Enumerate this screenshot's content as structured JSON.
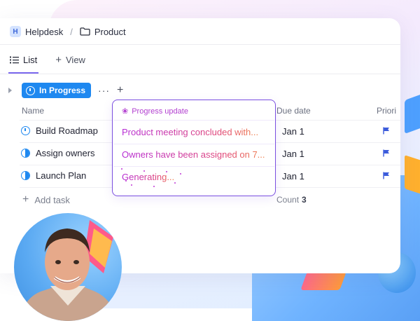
{
  "breadcrumb": {
    "space_initial": "H",
    "space_name": "Helpdesk",
    "separator": "/",
    "folder_name": "Product"
  },
  "views": {
    "list_label": "List",
    "add_view_label": "View"
  },
  "group": {
    "status_label": "In Progress",
    "status_color": "#1e88f0",
    "more": "···",
    "add": "+"
  },
  "columns": {
    "name": "Name",
    "due_date": "Due date",
    "priority": "Priori"
  },
  "ai_column": {
    "header": "Progress update",
    "cells": [
      "Product meeting concluded with...",
      "Owners have been assigned on 7...",
      "Generating..."
    ]
  },
  "tasks": [
    {
      "name": "Build Roadmap",
      "status_icon": "in-progress-icon",
      "due": "Jan 1",
      "flag_color": "#3b5bdb"
    },
    {
      "name": "Assign owners",
      "status_icon": "half-circle-icon",
      "due": "Jan 1",
      "flag_color": "#3b5bdb"
    },
    {
      "name": "Launch Plan",
      "status_icon": "half-circle-icon",
      "due": "Jan 1",
      "flag_color": "#3b5bdb"
    }
  ],
  "add_task_label": "Add task",
  "count": {
    "label": "Count",
    "value": "3"
  }
}
